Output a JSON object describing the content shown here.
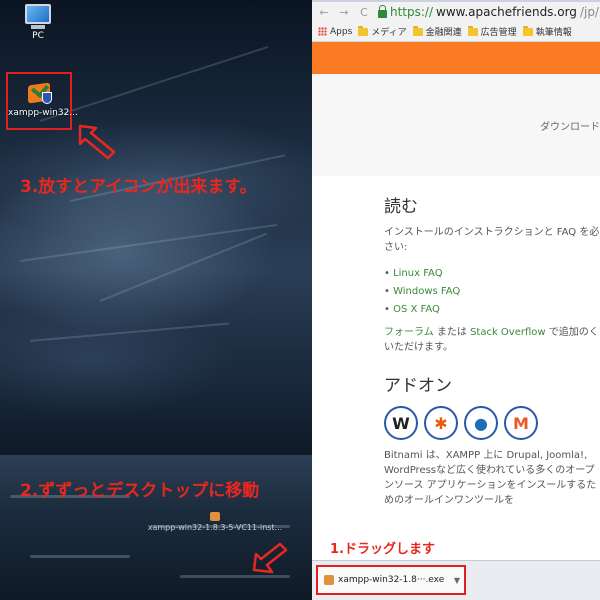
{
  "desktop": {
    "pc_label": "PC",
    "xampp_icon_label": "xampp-win32...",
    "drag_ghost_label": "xampp-win32-1.8.3-5-VC11-inst..."
  },
  "annotations": {
    "step3": "3.放すとアイコンが出来ます。",
    "step2": "2.ずずっとデスクトップに移動",
    "step1": "1.ドラッグします",
    "accent_color": "#e8281f"
  },
  "browser": {
    "url_scheme": "https://",
    "url_host": "www.apachefriends.org",
    "url_path": "/jp/",
    "bookmarks": [
      "Apps",
      "メディア",
      "金融関連",
      "広告管理",
      "執筆情報"
    ],
    "download_band_text": "ダウンロード",
    "content": {
      "read_heading": "読む",
      "read_paragraph": "インストールのインストラクションと FAQ を必さい:",
      "links": [
        "Linux FAQ",
        "Windows FAQ",
        "OS X FAQ"
      ],
      "forum_link": "フォーラム",
      "forum_middle": " または ",
      "stackoverflow_link": "Stack Overflow",
      "forum_tail": " で追加のく いただけます。",
      "addons_heading": "アドオン",
      "addon_icons": [
        "wordpress-icon",
        "joomla-icon",
        "drupal-icon",
        "magento-icon"
      ],
      "bitnami_paragraph": "Bitnami は、XAMPP 上に Drupal, Joomla!, WordPressなど広く使われている多くのオープンソース アプリケーションをインスールするためのオールインワンツールを"
    },
    "download_item": "xampp-win32-1.8···.exe",
    "brand_color": "#fb7a24"
  }
}
